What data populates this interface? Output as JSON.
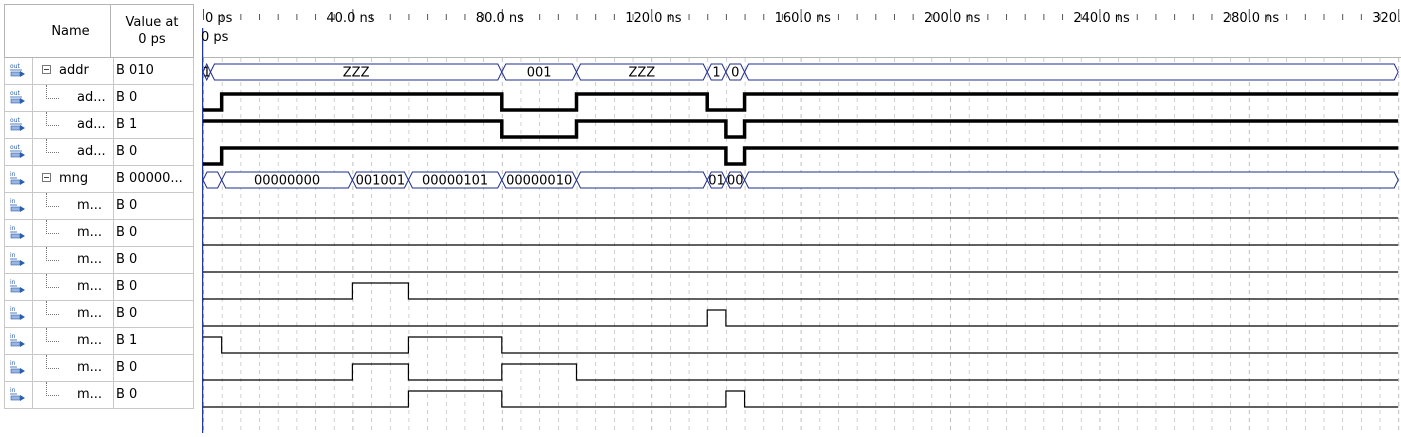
{
  "header": {
    "name_label": "Name",
    "value_label_line1": "Value at",
    "value_label_line2": "0 ps"
  },
  "cursor_label": "0 ps",
  "time_ticks": [
    "0 ps",
    "40.0 ns",
    "80.0 ns",
    "120.0 ns",
    "160.0 ns",
    "200.0 ns",
    "240.0 ns",
    "280.0 ns",
    "320.0"
  ],
  "signals": [
    {
      "dir": "out",
      "name": "addr",
      "value": "B 010",
      "bus": true,
      "expander": true
    },
    {
      "dir": "out",
      "name": "ad...",
      "value": "B 0",
      "bus": false
    },
    {
      "dir": "out",
      "name": "ad...",
      "value": "B 1",
      "bus": false
    },
    {
      "dir": "out",
      "name": "ad...",
      "value": "B 0",
      "bus": false
    },
    {
      "dir": "in",
      "name": "mng",
      "value": "B 00000...",
      "bus": true,
      "expander": true
    },
    {
      "dir": "in",
      "name": "m...",
      "value": "B 0",
      "bus": false
    },
    {
      "dir": "in",
      "name": "m...",
      "value": "B 0",
      "bus": false
    },
    {
      "dir": "in",
      "name": "m...",
      "value": "B 0",
      "bus": false
    },
    {
      "dir": "in",
      "name": "m...",
      "value": "B 0",
      "bus": false
    },
    {
      "dir": "in",
      "name": "m...",
      "value": "B 0",
      "bus": false
    },
    {
      "dir": "in",
      "name": "m...",
      "value": "B 1",
      "bus": false
    },
    {
      "dir": "in",
      "name": "m...",
      "value": "B 0",
      "bus": false
    },
    {
      "dir": "in",
      "name": "m...",
      "value": "B 0",
      "bus": false
    }
  ],
  "waveforms": {
    "time_unit": "ns",
    "visible_range_ns": [
      0,
      320
    ],
    "addr_bus_segments": [
      {
        "t0": 0,
        "t1": 2,
        "label": "1"
      },
      {
        "t0": 2,
        "t1": 80,
        "label": "ZZZ"
      },
      {
        "t0": 80,
        "t1": 100,
        "label": "001"
      },
      {
        "t0": 100,
        "t1": 135,
        "label": "ZZZ"
      },
      {
        "t0": 135,
        "t1": 140,
        "label": "1"
      },
      {
        "t0": 140,
        "t1": 145,
        "label": "0"
      },
      {
        "t0": 145,
        "t1": 320,
        "label": ""
      }
    ],
    "mng_bus_segments": [
      {
        "t0": 0,
        "t1": 5,
        "label": ""
      },
      {
        "t0": 5,
        "t1": 40,
        "label": "00000000"
      },
      {
        "t0": 40,
        "t1": 55,
        "label": "001001"
      },
      {
        "t0": 55,
        "t1": 80,
        "label": "00000101"
      },
      {
        "t0": 80,
        "t1": 100,
        "label": "00000010"
      },
      {
        "t0": 100,
        "t1": 135,
        "label": ""
      },
      {
        "t0": 135,
        "t1": 140,
        "label": "01"
      },
      {
        "t0": 140,
        "t1": 145,
        "label": "00"
      },
      {
        "t0": 145,
        "t1": 320,
        "label": ""
      }
    ],
    "bit_rows": [
      {
        "thick": true,
        "edges": [
          [
            0,
            0
          ],
          [
            5,
            1
          ],
          [
            80,
            0
          ],
          [
            100,
            1
          ],
          [
            135,
            0
          ],
          [
            145,
            1
          ]
        ]
      },
      {
        "thick": true,
        "edges": [
          [
            0,
            1
          ],
          [
            5,
            1
          ],
          [
            80,
            0
          ],
          [
            100,
            1
          ],
          [
            135,
            1
          ],
          [
            140,
            0
          ],
          [
            145,
            1
          ]
        ]
      },
      {
        "thick": true,
        "edges": [
          [
            0,
            0
          ],
          [
            5,
            1
          ],
          [
            80,
            1
          ],
          [
            100,
            1
          ],
          [
            135,
            1
          ],
          [
            140,
            0
          ],
          [
            145,
            1
          ]
        ]
      },
      null,
      {
        "thick": false,
        "edges": [
          [
            0,
            0
          ]
        ]
      },
      {
        "thick": false,
        "edges": [
          [
            0,
            0
          ]
        ]
      },
      {
        "thick": false,
        "edges": [
          [
            0,
            0
          ]
        ]
      },
      {
        "thick": false,
        "edges": [
          [
            0,
            0
          ],
          [
            40,
            1
          ],
          [
            55,
            0
          ]
        ]
      },
      {
        "thick": false,
        "edges": [
          [
            0,
            0
          ],
          [
            135,
            1
          ],
          [
            140,
            0
          ]
        ]
      },
      {
        "thick": false,
        "edges": [
          [
            0,
            1
          ],
          [
            5,
            0
          ],
          [
            55,
            1
          ],
          [
            80,
            0
          ]
        ]
      },
      {
        "thick": false,
        "edges": [
          [
            0,
            0
          ],
          [
            40,
            1
          ],
          [
            55,
            0
          ],
          [
            80,
            1
          ],
          [
            100,
            0
          ]
        ]
      },
      {
        "thick": false,
        "edges": [
          [
            0,
            0
          ],
          [
            55,
            1
          ],
          [
            80,
            0
          ],
          [
            140,
            1
          ],
          [
            145,
            0
          ]
        ]
      }
    ]
  }
}
